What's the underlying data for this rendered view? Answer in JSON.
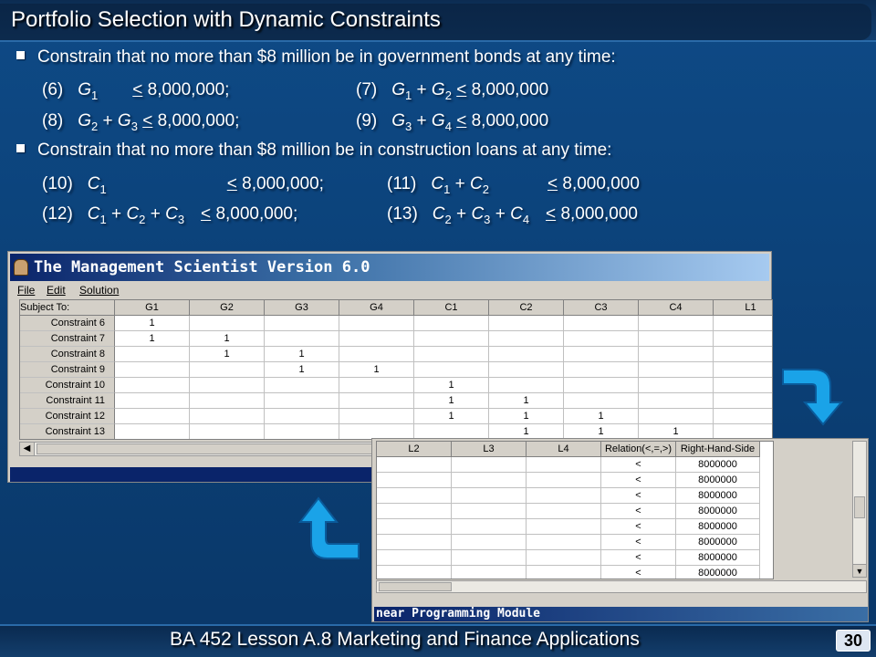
{
  "slide": {
    "title": "Portfolio Selection with Dynamic Constraints",
    "bullet1": "Constrain that no more than $8 million be in government bonds at any time:",
    "bullet2": "Constrain that no more than $8 million be in construction loans at any time:",
    "footer": "BA 452  Lesson A.8 Marketing and Finance Applications",
    "page_number": "30"
  },
  "equations": {
    "e6": {
      "num": "(6)",
      "lhs1": "G",
      "s1": "1",
      "rel": "<",
      "rhs": "8,000,000;"
    },
    "e7": {
      "num": "(7)",
      "lhs1": "G",
      "s1": "1",
      "plus": "+",
      "lhs2": "G",
      "s2": "2",
      "rel": "<",
      "rhs": "8,000,000"
    },
    "e8": {
      "num": "(8)",
      "lhs1": "G",
      "s1": "2",
      "plus": "+",
      "lhs2": "G",
      "s2": "3",
      "rel": "<",
      "rhs": "8,000,000;"
    },
    "e9": {
      "num": "(9)",
      "lhs1": "G",
      "s1": "3",
      "plus": "+",
      "lhs2": "G",
      "s2": "4",
      "rel": "<",
      "rhs": "8,000,000"
    },
    "e10": {
      "num": "(10)",
      "lhs1": "C",
      "s1": "1",
      "rel": "<",
      "rhs": "8,000,000;"
    },
    "e11": {
      "num": "(11)",
      "lhs1": "C",
      "s1": "1",
      "plus": "+",
      "lhs2": "C",
      "s2": "2",
      "rel": "<",
      "rhs": "8,000,000"
    },
    "e12": {
      "num": "(12)",
      "lhs1": "C",
      "s1": "1",
      "plus": "+",
      "lhs2": "C",
      "s2": "2",
      "plus2": "+",
      "lhs3": "C",
      "s3": "3",
      "rel": "<",
      "rhs": "8,000,000;"
    },
    "e13": {
      "num": "(13)",
      "lhs1": "C",
      "s1": "2",
      "plus": "+",
      "lhs2": "C",
      "s2": "3",
      "plus2": "+",
      "lhs3": "C",
      "s3": "4",
      "rel": "<",
      "rhs": "8,000,000"
    }
  },
  "window1": {
    "title": "The Management Scientist Version 6.0",
    "menu": [
      "File",
      "Edit",
      "Solution"
    ],
    "corner_header": "Subject To:",
    "columns": [
      "G1",
      "G2",
      "G3",
      "G4",
      "C1",
      "C2",
      "C3",
      "C4",
      "L1"
    ],
    "rows": [
      {
        "label": "Constraint 6",
        "cells": [
          "1",
          "",
          "",
          "",
          "",
          "",
          "",
          "",
          ""
        ]
      },
      {
        "label": "Constraint 7",
        "cells": [
          "1",
          "1",
          "",
          "",
          "",
          "",
          "",
          "",
          ""
        ]
      },
      {
        "label": "Constraint 8",
        "cells": [
          "",
          "1",
          "1",
          "",
          "",
          "",
          "",
          "",
          ""
        ]
      },
      {
        "label": "Constraint 9",
        "cells": [
          "",
          "",
          "1",
          "1",
          "",
          "",
          "",
          "",
          ""
        ]
      },
      {
        "label": "Constraint 10",
        "cells": [
          "",
          "",
          "",
          "",
          "1",
          "",
          "",
          "",
          ""
        ]
      },
      {
        "label": "Constraint 11",
        "cells": [
          "",
          "",
          "",
          "",
          "1",
          "1",
          "",
          "",
          ""
        ]
      },
      {
        "label": "Constraint 12",
        "cells": [
          "",
          "",
          "",
          "",
          "1",
          "1",
          "1",
          "",
          ""
        ]
      },
      {
        "label": "Constraint 13",
        "cells": [
          "",
          "",
          "",
          "",
          "",
          "1",
          "1",
          "1",
          ""
        ]
      }
    ]
  },
  "window2": {
    "title": "near Programming Module",
    "columns": [
      "L2",
      "L3",
      "L4",
      "Relation(<,=,>)",
      "Right-Hand-Side"
    ],
    "rows": [
      {
        "cells": [
          "",
          "",
          "",
          "<",
          "8000000"
        ]
      },
      {
        "cells": [
          "",
          "",
          "",
          "<",
          "8000000"
        ]
      },
      {
        "cells": [
          "",
          "",
          "",
          "<",
          "8000000"
        ]
      },
      {
        "cells": [
          "",
          "",
          "",
          "<",
          "8000000"
        ]
      },
      {
        "cells": [
          "",
          "",
          "",
          "<",
          "8000000"
        ]
      },
      {
        "cells": [
          "",
          "",
          "",
          "<",
          "8000000"
        ]
      },
      {
        "cells": [
          "",
          "",
          "",
          "<",
          "8000000"
        ]
      },
      {
        "cells": [
          "",
          "",
          "",
          "<",
          "8000000"
        ]
      }
    ]
  },
  "colors": {
    "background": "#0b3f75",
    "text": "#ffffff",
    "arrow": "#1aa3e8",
    "win_title": "#0a246a"
  },
  "icons": {
    "arrow_down": "curved-arrow-down-icon",
    "arrow_up": "curved-arrow-up-icon",
    "app_logo": "management-scientist-logo-icon"
  }
}
